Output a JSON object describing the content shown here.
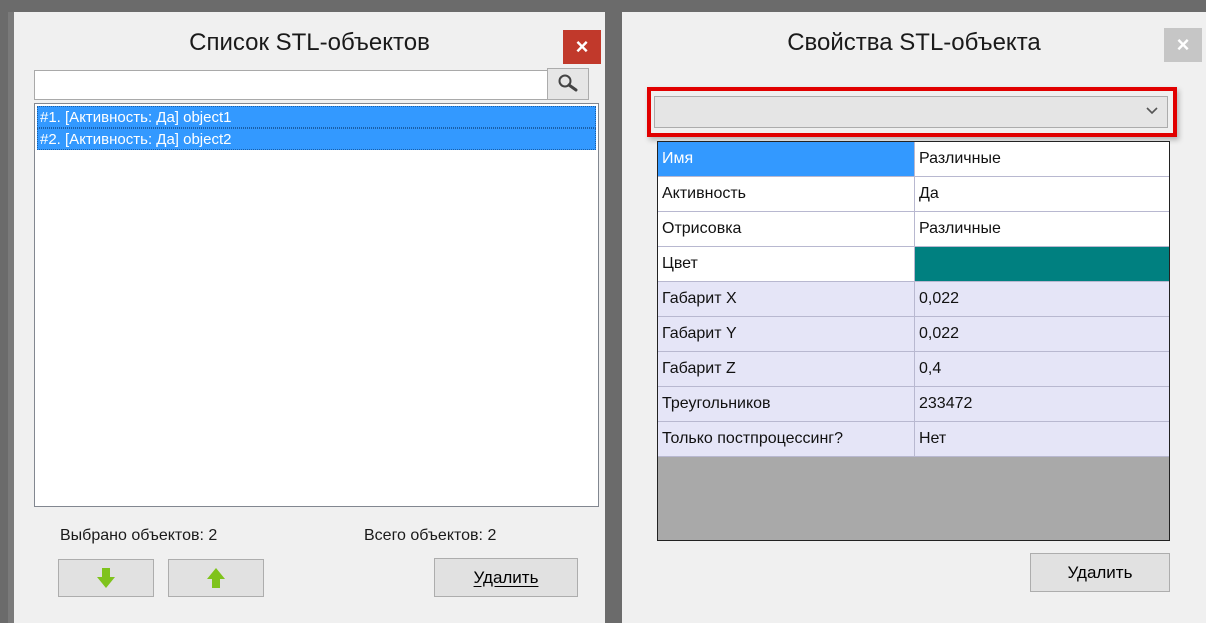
{
  "left_panel": {
    "title": "Список STL-объектов",
    "close_label": "×",
    "search": {
      "value": "",
      "placeholder": ""
    },
    "items": [
      {
        "label": "#1. [Активность: Да] object1"
      },
      {
        "label": "#2. [Активность: Да] object2"
      }
    ],
    "selected_count": "Выбрано объектов: 2",
    "total_count": "Всего объектов: 2",
    "delete_label": "Удалить"
  },
  "right_panel": {
    "title": "Свойства STL-объекта",
    "close_label": "×",
    "dropdown": {
      "selected": ""
    },
    "properties": [
      {
        "key": "Имя",
        "value": "Различные"
      },
      {
        "key": "Активность",
        "value": "Да"
      },
      {
        "key": "Отрисовка",
        "value": "Различные"
      },
      {
        "key": "Цвет",
        "value": ""
      },
      {
        "key": "Габарит X",
        "value": "0,022"
      },
      {
        "key": "Габарит Y",
        "value": "0,022"
      },
      {
        "key": "Габарит Z",
        "value": "0,4"
      },
      {
        "key": "Треугольников",
        "value": "233472"
      },
      {
        "key": "Только постпроцессинг?",
        "value": "Нет"
      }
    ],
    "delete_label": "Удалить"
  },
  "colors": {
    "selection": "#3399ff",
    "object_color": "#008080",
    "highlight_border": "#e10000",
    "close_active": "#c1392b",
    "arrow_green": "#7fc31c"
  },
  "icons": {
    "search": "magnifier-icon",
    "move_down": "arrow-down-icon",
    "move_up": "arrow-up-icon",
    "dropdown": "chevron-down-icon"
  }
}
